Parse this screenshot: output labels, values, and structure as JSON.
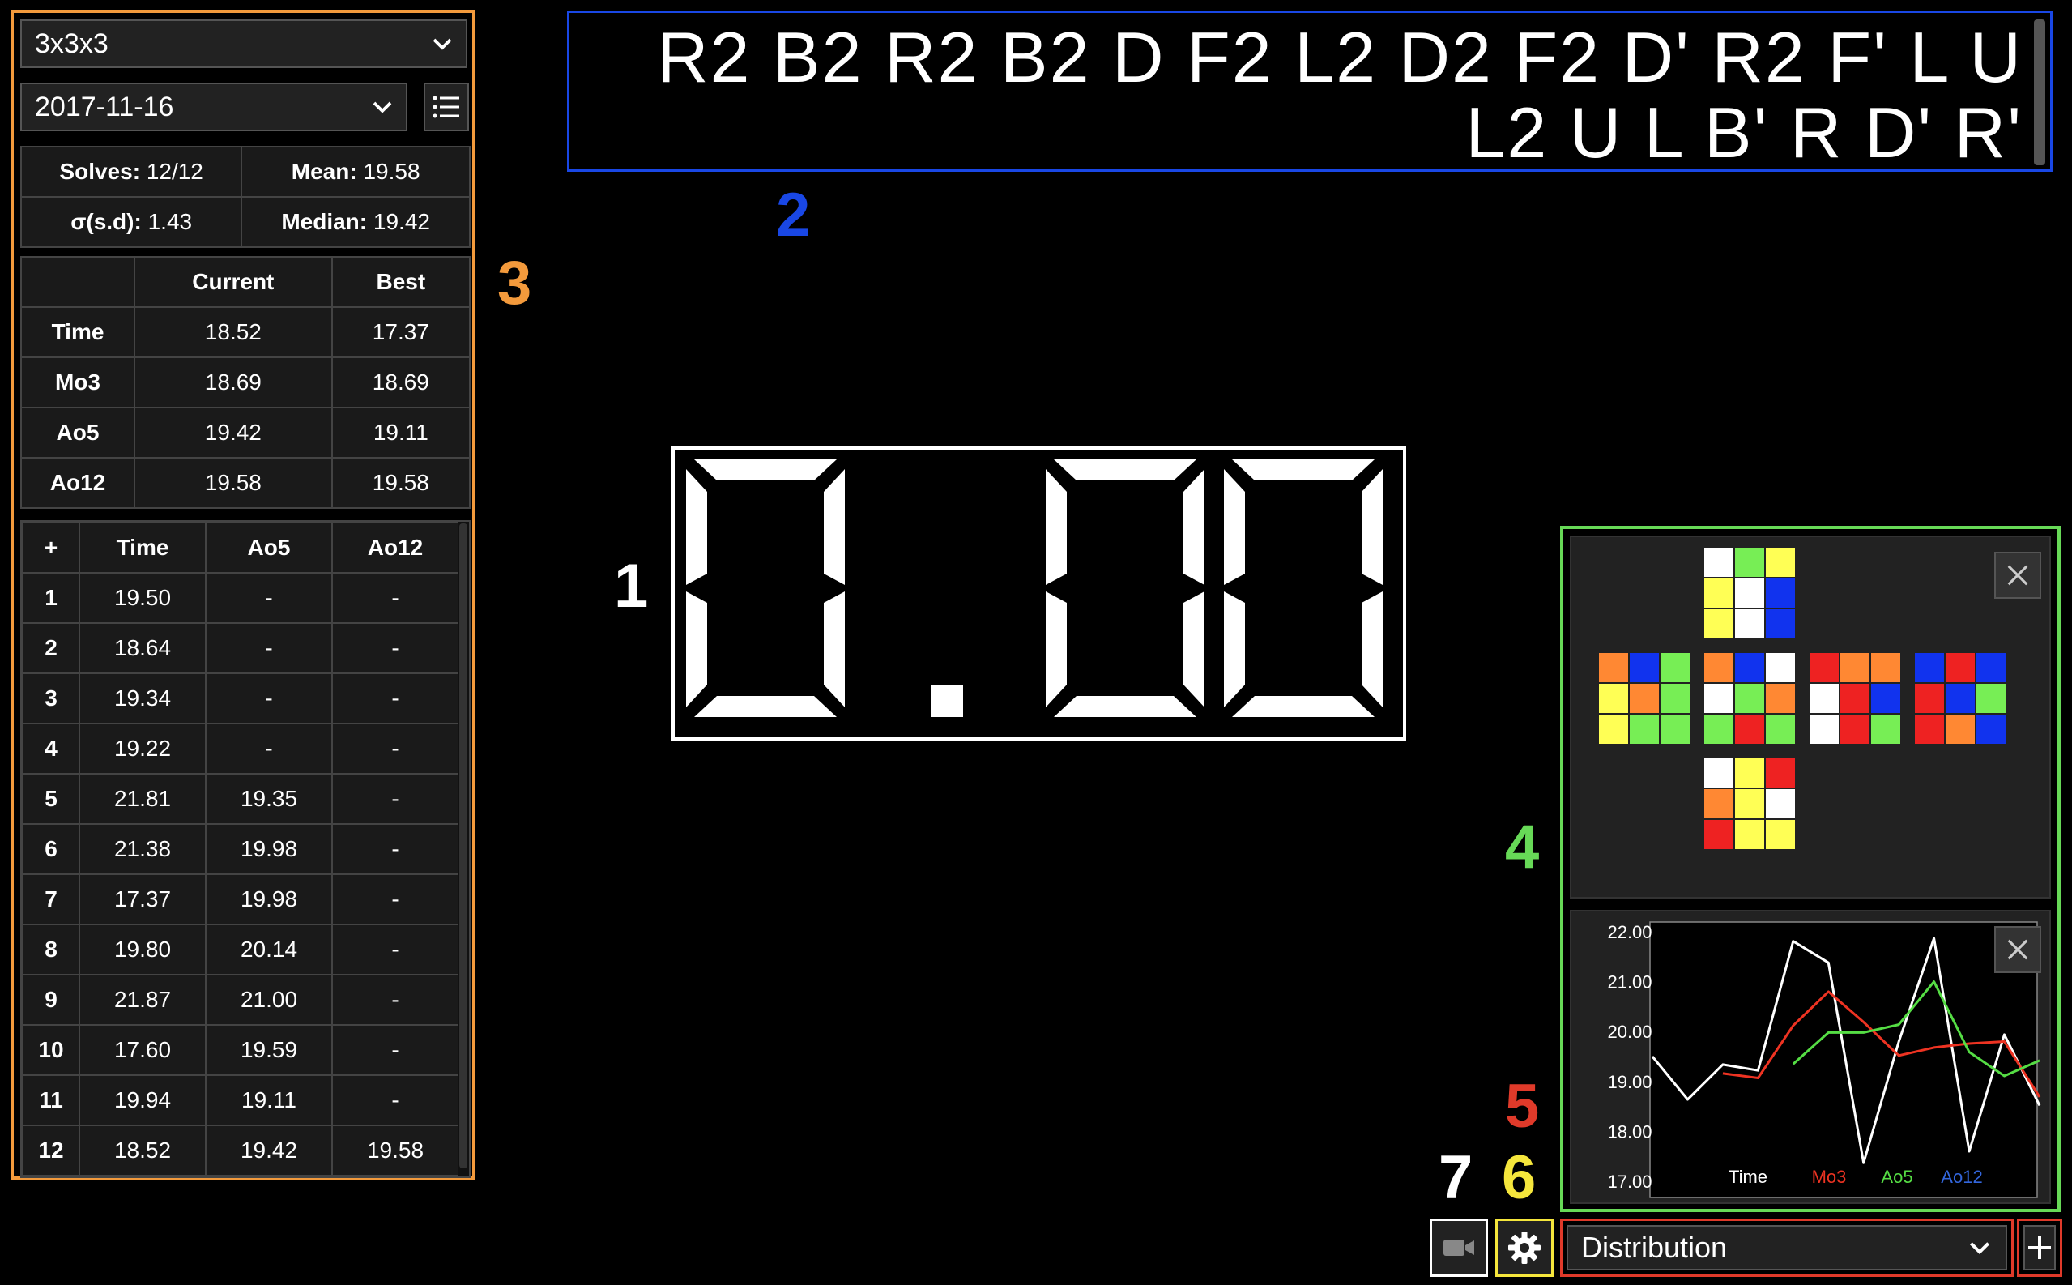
{
  "puzzle": {
    "selected": "3x3x3"
  },
  "session": {
    "selected": "2017-11-16"
  },
  "summary": {
    "solves_label": "Solves:",
    "solves_value": "12/12",
    "mean_label": "Mean:",
    "mean_value": "19.58",
    "sd_label": "σ(s.d):",
    "sd_value": "1.43",
    "median_label": "Median:",
    "median_value": "19.42"
  },
  "records": {
    "headers": [
      "",
      "Current",
      "Best"
    ],
    "rows": [
      {
        "label": "Time",
        "current": "18.52",
        "best": "17.37"
      },
      {
        "label": "Mo3",
        "current": "18.69",
        "best": "18.69"
      },
      {
        "label": "Ao5",
        "current": "19.42",
        "best": "19.11"
      },
      {
        "label": "Ao12",
        "current": "19.58",
        "best": "19.58"
      }
    ]
  },
  "solves": {
    "headers": [
      "+",
      "Time",
      "Ao5",
      "Ao12"
    ],
    "rows": [
      [
        "1",
        "19.50",
        "-",
        "-"
      ],
      [
        "2",
        "18.64",
        "-",
        "-"
      ],
      [
        "3",
        "19.34",
        "-",
        "-"
      ],
      [
        "4",
        "19.22",
        "-",
        "-"
      ],
      [
        "5",
        "21.81",
        "19.35",
        "-"
      ],
      [
        "6",
        "21.38",
        "19.98",
        "-"
      ],
      [
        "7",
        "17.37",
        "19.98",
        "-"
      ],
      [
        "8",
        "19.80",
        "20.14",
        "-"
      ],
      [
        "9",
        "21.87",
        "21.00",
        "-"
      ],
      [
        "10",
        "17.60",
        "19.59",
        "-"
      ],
      [
        "11",
        "19.94",
        "19.11",
        "-"
      ],
      [
        "12",
        "18.52",
        "19.42",
        "19.58"
      ]
    ]
  },
  "scramble": {
    "line1": "R2 B2 R2 B2 D F2 L2 D2 F2 D' R2 F' L U",
    "line2": "L2 U L B' R D' R'"
  },
  "timer": {
    "display": "0.00"
  },
  "annotations": [
    "1",
    "2",
    "3",
    "4",
    "5",
    "6",
    "7"
  ],
  "annotation_colors": {
    "1": "#ffffff",
    "2": "#1947e5",
    "3": "#f39a3c",
    "4": "#67d957",
    "5": "#e03a2a",
    "6": "#f5e63c",
    "7": "#ffffff"
  },
  "cube_net": {
    "colors": {
      "W": "#ffffff",
      "Y": "#ffff55",
      "G": "#77ee55",
      "B": "#1133ee",
      "O": "#ff8833",
      "R": "#ee2222"
    },
    "U": [
      [
        "W",
        "G",
        "Y"
      ],
      [
        "Y",
        "W",
        "B"
      ],
      [
        "Y",
        "W",
        "B"
      ]
    ],
    "L": [
      [
        "O",
        "B",
        "G"
      ],
      [
        "Y",
        "O",
        "G"
      ],
      [
        "Y",
        "G",
        "G"
      ]
    ],
    "F": [
      [
        "O",
        "B",
        "W"
      ],
      [
        "W",
        "G",
        "O"
      ],
      [
        "G",
        "R",
        "G"
      ]
    ],
    "R": [
      [
        "R",
        "O",
        "O"
      ],
      [
        "W",
        "R",
        "B"
      ],
      [
        "W",
        "R",
        "G"
      ]
    ],
    "B": [
      [
        "B",
        "R",
        "B"
      ],
      [
        "R",
        "B",
        "G"
      ],
      [
        "R",
        "O",
        "B"
      ]
    ],
    "D": [
      [
        "W",
        "Y",
        "R"
      ],
      [
        "O",
        "Y",
        "W"
      ],
      [
        "R",
        "Y",
        "Y"
      ]
    ]
  },
  "chart_data": {
    "type": "line",
    "x": [
      1,
      2,
      3,
      4,
      5,
      6,
      7,
      8,
      9,
      10,
      11,
      12
    ],
    "ylim": [
      17.0,
      22.0
    ],
    "yticks": [
      "22.00",
      "21.00",
      "20.00",
      "19.00",
      "18.00",
      "17.00"
    ],
    "series": [
      {
        "name": "Time",
        "color": "#ffffff",
        "values": [
          19.5,
          18.64,
          19.34,
          19.22,
          21.81,
          21.38,
          17.37,
          19.8,
          21.87,
          17.6,
          19.94,
          18.52
        ]
      },
      {
        "name": "Mo3",
        "color": "#ee3322",
        "values": [
          null,
          null,
          19.16,
          19.07,
          20.12,
          20.8,
          20.19,
          19.52,
          19.68,
          19.76,
          19.8,
          18.69
        ]
      },
      {
        "name": "Ao5",
        "color": "#55dd44",
        "values": [
          null,
          null,
          null,
          null,
          19.35,
          19.98,
          19.98,
          20.14,
          21.0,
          19.59,
          19.11,
          19.42
        ]
      },
      {
        "name": "Ao12",
        "color": "#3366dd",
        "values": [
          null,
          null,
          null,
          null,
          null,
          null,
          null,
          null,
          null,
          null,
          null,
          19.58
        ]
      }
    ]
  },
  "chart_select": {
    "selected": "Distribution"
  },
  "icons": {
    "camera": "camera-icon",
    "settings": "gear-icon",
    "add": "plus-icon",
    "list": "list-icon",
    "close": "close-icon"
  }
}
